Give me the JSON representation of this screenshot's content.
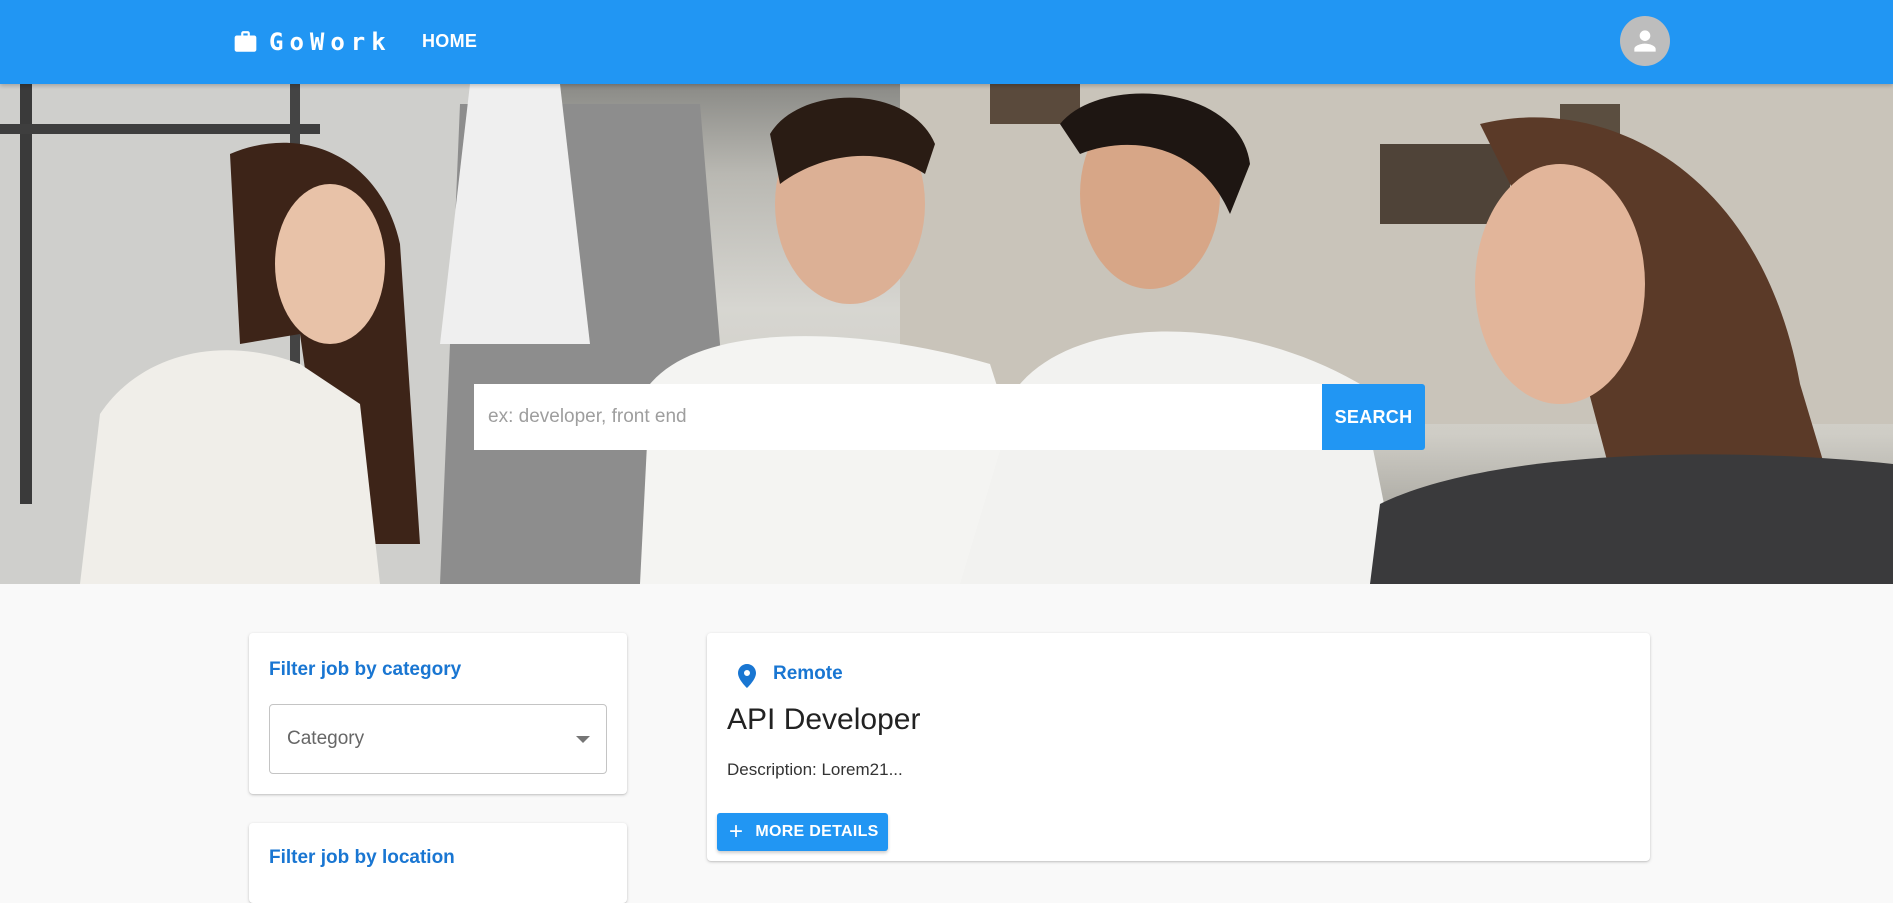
{
  "header": {
    "brand": "GoWork",
    "brand_icon": "briefcase-icon",
    "nav_home": "HOME",
    "avatar_icon": "account-icon"
  },
  "search": {
    "placeholder": "ex: developer, front end",
    "value": "",
    "button_label": "SEARCH"
  },
  "filters": {
    "category_title": "Filter job by category",
    "category_select_label": "Category",
    "location_title": "Filter job by location"
  },
  "jobs": [
    {
      "location": "Remote",
      "title": "API Developer",
      "description": "Description: Lorem21...",
      "button_label": "MORE DETAILS"
    }
  ],
  "colors": {
    "primary": "#2196f3",
    "accent_text": "#1976d2",
    "page_bg": "#f9f9f9"
  }
}
